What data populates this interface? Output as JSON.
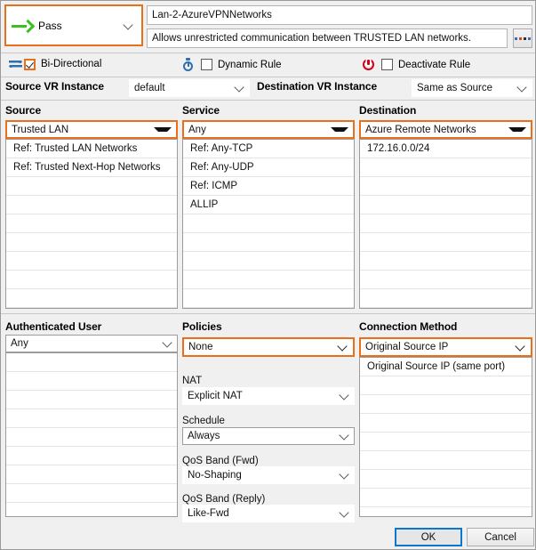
{
  "action": {
    "label": "Pass",
    "icon": "green-arrow-icon",
    "accent_color": "#3ac11e",
    "highlight_color": "#e8701a"
  },
  "rule": {
    "name_value": "Lan-2-AzureVPNNetworks",
    "name_placeholder": "Rule name",
    "description_value": "Allows unrestricted communication between TRUSTED LAN networks.",
    "description_placeholder": "Description",
    "more_button_label": "..."
  },
  "flags": {
    "bidirectional": {
      "label": "Bi-Directional",
      "checked": true,
      "icon": "bidirectional-arrows-icon"
    },
    "dynamic_rule": {
      "label": "Dynamic Rule",
      "checked": false,
      "icon": "stopwatch-icon"
    },
    "deactivate_rule": {
      "label": "Deactivate Rule",
      "checked": false,
      "icon": "power-icon"
    }
  },
  "vr": {
    "source_label": "Source VR Instance",
    "source_value": "default",
    "destination_label": "Destination VR Instance",
    "destination_value": "Same as Source"
  },
  "source": {
    "title": "Source",
    "selected": "Trusted  LAN",
    "items": [
      "Ref: Trusted LAN Networks",
      "Ref: Trusted Next-Hop Networks"
    ]
  },
  "service": {
    "title": "Service",
    "selected": "Any",
    "items": [
      "Ref: Any-TCP",
      "Ref: Any-UDP",
      "Ref: ICMP",
      "ALLIP"
    ]
  },
  "destination": {
    "title": "Destination",
    "selected": "Azure Remote Networks",
    "items": [
      "172.16.0.0/24"
    ]
  },
  "authenticated_user": {
    "title": "Authenticated User",
    "selected": "Any",
    "items": []
  },
  "policies": {
    "title": "Policies",
    "selected": "None",
    "nat_label": "NAT",
    "nat_value": "Explicit NAT",
    "schedule_label": "Schedule",
    "schedule_value": "Always",
    "qos_fwd_label": "QoS Band (Fwd)",
    "qos_fwd_value": "No-Shaping",
    "qos_reply_label": "QoS Band (Reply)",
    "qos_reply_value": "Like-Fwd"
  },
  "connection_method": {
    "title": "Connection Method",
    "selected": "Original Source IP",
    "items": [
      "Original Source IP (same port)"
    ]
  },
  "footer": {
    "ok_label": "OK",
    "cancel_label": "Cancel"
  }
}
